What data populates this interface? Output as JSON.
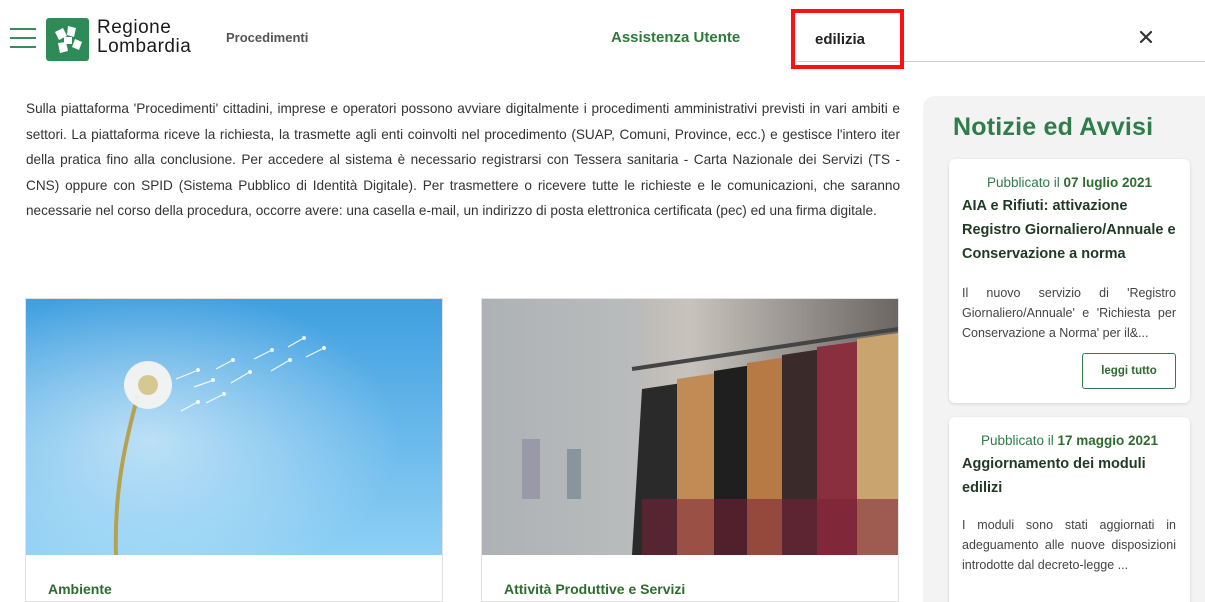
{
  "header": {
    "brand_line1": "Regione",
    "brand_line2": "Lombardia",
    "nav_procedimenti": "Procedimenti",
    "nav_assistenza": "Assistenza Utente",
    "search_value": "edilizia",
    "clear_icon": "close-icon",
    "menu_icon": "hamburger-menu-icon"
  },
  "intro": {
    "text": "Sulla piattaforma 'Procedimenti' cittadini, imprese e operatori possono avviare digitalmente i procedimenti amministrativi previsti in vari ambiti e settori. La piattaforma riceve la richiesta, la trasmette agli enti coinvolti nel procedimento (SUAP, Comuni, Province, ecc.) e gestisce l'intero iter della pratica fino alla conclusione. Per accedere al sistema è necessario registrarsi con Tessera sanitaria - Carta Nazionale dei Servizi (TS - CNS) oppure con SPID (Sistema Pubblico di Identità Digitale). Per trasmettere o ricevere tutte le richieste e le comunicazioni, che saranno necessarie nel corso della procedura, occorre avere: una casella e-mail, un indirizzo di posta elettronica certificata (pec) ed una firma digitale."
  },
  "cards": [
    {
      "title": "Ambiente",
      "image": "dandelion-sky"
    },
    {
      "title": "Attività Produttive e Servizi",
      "image": "clothing-rack"
    }
  ],
  "sidebar": {
    "title": "Notizie ed Avvisi",
    "news": [
      {
        "date_prefix": "Pubblicato il",
        "date": "07 luglio 2021",
        "title": "AIA e Rifiuti: attivazione Registro Giornaliero/Annuale e Conservazione a norma",
        "description": "Il nuovo servizio di 'Registro Giornaliero/Annuale' e 'Richiesta per Conservazione a Norma' per il&...",
        "button": "leggi tutto"
      },
      {
        "date_prefix": "Pubblicato il",
        "date": "17 maggio 2021",
        "title": "Aggiornamento dei moduli edilizi",
        "description": "I moduli sono stati aggiornati in adeguamento alle nuove disposizioni introdotte dal decreto-legge ..."
      }
    ]
  },
  "colors": {
    "brand_green": "#2e8b57",
    "accent_green": "#2e7d4a",
    "highlight_red": "#ff1010"
  }
}
